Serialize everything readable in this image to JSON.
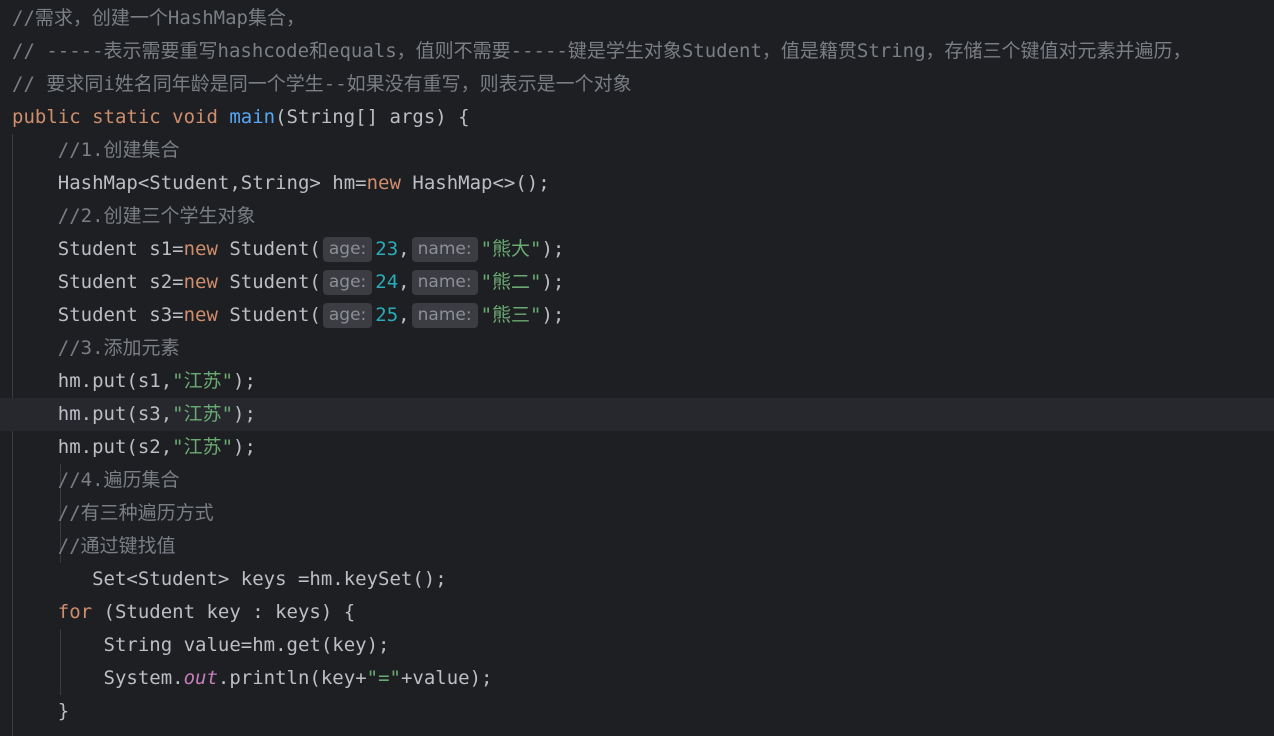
{
  "editor": {
    "language": "java",
    "theme_colors": {
      "background": "#1e1f22",
      "current_line": "#26282e",
      "default_text": "#bcbec4",
      "keyword": "#cf8e6d",
      "method_declaration": "#56a8f5",
      "comment": "#7a7e85",
      "string": "#6aab73",
      "number": "#2aacb8",
      "static_field": "#c77dbb",
      "inlay_hint_bg": "#3b3d42",
      "inlay_hint_text": "#8c8f96"
    },
    "current_line_index": 12,
    "lines": [
      [
        {
          "t": "cm",
          "v": "//需求，创建一个HashMap集合，"
        }
      ],
      [
        {
          "t": "cm",
          "v": "// -----表示需要重写hashcode和equals，值则不需要-----键是学生对象Student，值是籍贯String，存储三个键值对元素并遍历，"
        }
      ],
      [
        {
          "t": "cm",
          "v": "// 要求同i姓名同年龄是同一个学生--如果没有重写，则表示是一个对象"
        }
      ],
      [
        {
          "t": "kw",
          "v": "public static void "
        },
        {
          "t": "fn",
          "v": "main"
        },
        {
          "t": "tx",
          "v": "(String[] args) {"
        }
      ],
      [
        {
          "t": "tx",
          "v": "    "
        },
        {
          "t": "cm",
          "v": "//1.创建集合"
        }
      ],
      [
        {
          "t": "tx",
          "v": "    HashMap<Student,String> hm="
        },
        {
          "t": "kw",
          "v": "new"
        },
        {
          "t": "tx",
          "v": " HashMap<>();"
        }
      ],
      [
        {
          "t": "tx",
          "v": "    "
        },
        {
          "t": "cm",
          "v": "//2.创建三个学生对象"
        }
      ],
      [
        {
          "t": "tx",
          "v": "    Student s1="
        },
        {
          "t": "kw",
          "v": "new"
        },
        {
          "t": "tx",
          "v": " Student("
        },
        {
          "t": "hint",
          "v": "age:"
        },
        {
          "t": "num",
          "v": "23"
        },
        {
          "t": "tx",
          "v": ","
        },
        {
          "t": "hint",
          "v": "name:"
        },
        {
          "t": "str",
          "v": "\"熊大\""
        },
        {
          "t": "tx",
          "v": ");"
        }
      ],
      [
        {
          "t": "tx",
          "v": "    Student s2="
        },
        {
          "t": "kw",
          "v": "new"
        },
        {
          "t": "tx",
          "v": " Student("
        },
        {
          "t": "hint",
          "v": "age:"
        },
        {
          "t": "num",
          "v": "24"
        },
        {
          "t": "tx",
          "v": ","
        },
        {
          "t": "hint",
          "v": "name:"
        },
        {
          "t": "str",
          "v": "\"熊二\""
        },
        {
          "t": "tx",
          "v": ");"
        }
      ],
      [
        {
          "t": "tx",
          "v": "    Student s3="
        },
        {
          "t": "kw",
          "v": "new"
        },
        {
          "t": "tx",
          "v": " Student("
        },
        {
          "t": "hint",
          "v": "age:"
        },
        {
          "t": "num",
          "v": "25"
        },
        {
          "t": "tx",
          "v": ","
        },
        {
          "t": "hint",
          "v": "name:"
        },
        {
          "t": "str",
          "v": "\"熊三\""
        },
        {
          "t": "tx",
          "v": ");"
        }
      ],
      [
        {
          "t": "tx",
          "v": "    "
        },
        {
          "t": "cm",
          "v": "//3.添加元素"
        }
      ],
      [
        {
          "t": "tx",
          "v": "    hm.put(s1,"
        },
        {
          "t": "str",
          "v": "\"江苏\""
        },
        {
          "t": "tx",
          "v": ");"
        }
      ],
      [
        {
          "t": "tx",
          "v": "    hm.put(s3,"
        },
        {
          "t": "str",
          "v": "\"江苏\""
        },
        {
          "t": "tx",
          "v": ");"
        }
      ],
      [
        {
          "t": "tx",
          "v": "    hm.put(s2,"
        },
        {
          "t": "str",
          "v": "\"江苏\""
        },
        {
          "t": "tx",
          "v": ");"
        }
      ],
      [
        {
          "t": "tx",
          "v": "    "
        },
        {
          "t": "cm",
          "v": "//4.遍历集合"
        }
      ],
      [
        {
          "t": "tx",
          "v": "    "
        },
        {
          "t": "cm",
          "v": "//有三种遍历方式"
        }
      ],
      [
        {
          "t": "tx",
          "v": "    "
        },
        {
          "t": "cm",
          "v": "//通过键找值"
        }
      ],
      [
        {
          "t": "tx",
          "v": "       Set<Student> keys =hm.keySet();"
        }
      ],
      [
        {
          "t": "tx",
          "v": "    "
        },
        {
          "t": "kw",
          "v": "for"
        },
        {
          "t": "tx",
          "v": " (Student key : keys) {"
        }
      ],
      [
        {
          "t": "tx",
          "v": "        String value=hm.get(key);"
        }
      ],
      [
        {
          "t": "tx",
          "v": "        System."
        },
        {
          "t": "fld",
          "v": "out"
        },
        {
          "t": "tx",
          "v": ".println(key+"
        },
        {
          "t": "str",
          "v": "\"=\""
        },
        {
          "t": "tx",
          "v": "+value);"
        }
      ],
      [
        {
          "t": "tx",
          "v": "    }"
        }
      ]
    ]
  }
}
